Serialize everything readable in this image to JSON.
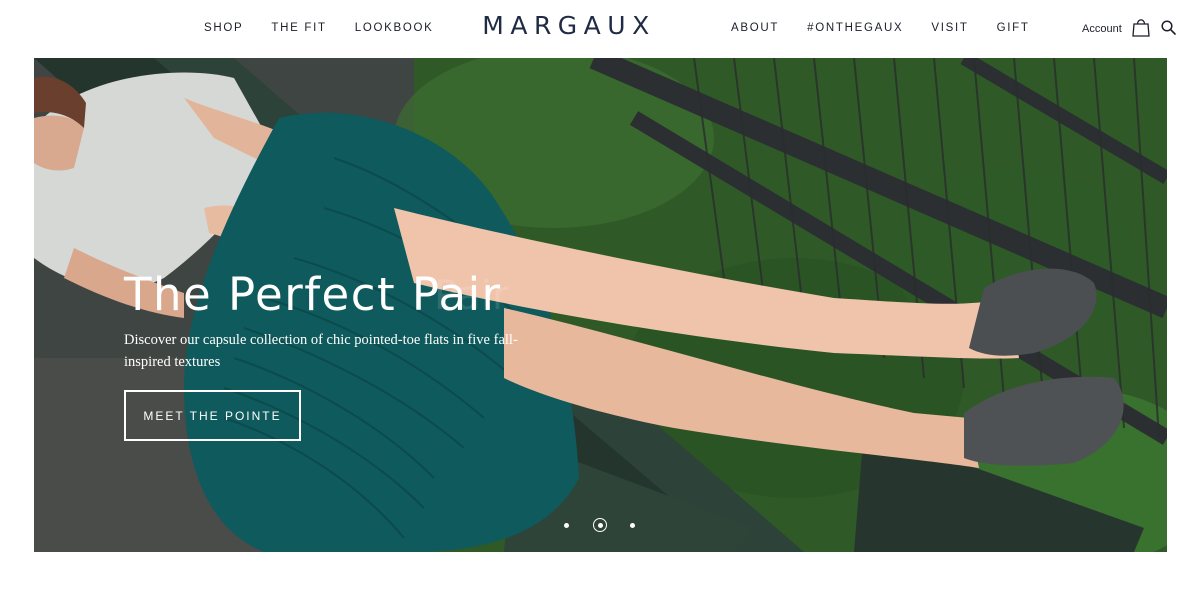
{
  "brand": {
    "logo": "MARGAUX"
  },
  "nav_left": [
    {
      "label": "SHOP"
    },
    {
      "label": "THE FIT"
    },
    {
      "label": "LOOKBOOK"
    }
  ],
  "nav_right": [
    {
      "label": "ABOUT"
    },
    {
      "label": "#ONTHEGAUX"
    },
    {
      "label": "VISIT"
    },
    {
      "label": "GIFT"
    }
  ],
  "utility": {
    "account_label": "Account",
    "bag_icon": "shopping-bag-icon",
    "search_icon": "search-icon"
  },
  "hero": {
    "title": "The Perfect Pair",
    "ghost_text": "Pair",
    "subtitle": "Discover our capsule collection of chic pointed-toe flats in five fall-inspired textures",
    "cta_label": "MEET THE POINTE",
    "carousel": {
      "slide_count": 3,
      "active_slide": 2
    }
  },
  "colors": {
    "text": "#1c1f2a",
    "logo": "#1f2a44",
    "dress": "#0f5a5c",
    "foliage": "#2e5a26",
    "white": "#ffffff"
  }
}
